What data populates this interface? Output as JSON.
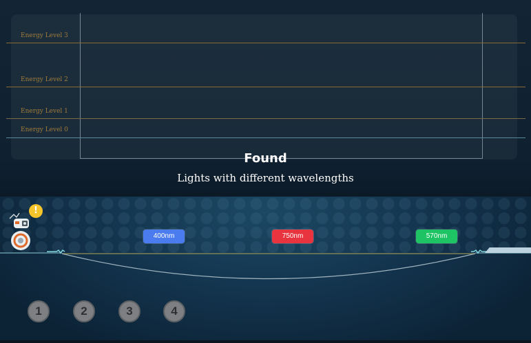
{
  "energy_levels": [
    {
      "label": "Energy Level 3",
      "color": "#8a6a35"
    },
    {
      "label": "Energy Level 2",
      "color": "#8a6a35"
    },
    {
      "label": "Energy Level 1",
      "color": "#7a6a45"
    },
    {
      "label": "Energy Level 0",
      "color": "#5a8a9a"
    }
  ],
  "found": {
    "title": "Found",
    "subtitle": "Lights with different wavelengths"
  },
  "alert": {
    "symbol": "!",
    "color": "#f6c42b"
  },
  "wavelengths": [
    {
      "label": "400nm",
      "color": "#4a7cf0"
    },
    {
      "label": "750nm",
      "color": "#e8343f"
    },
    {
      "label": "570nm",
      "color": "#1ec463"
    }
  ],
  "slots": [
    "1",
    "2",
    "3",
    "4"
  ],
  "icons": {
    "robot": "robot-icon",
    "alert": "exclamation-icon",
    "platform": "platform-icon"
  }
}
